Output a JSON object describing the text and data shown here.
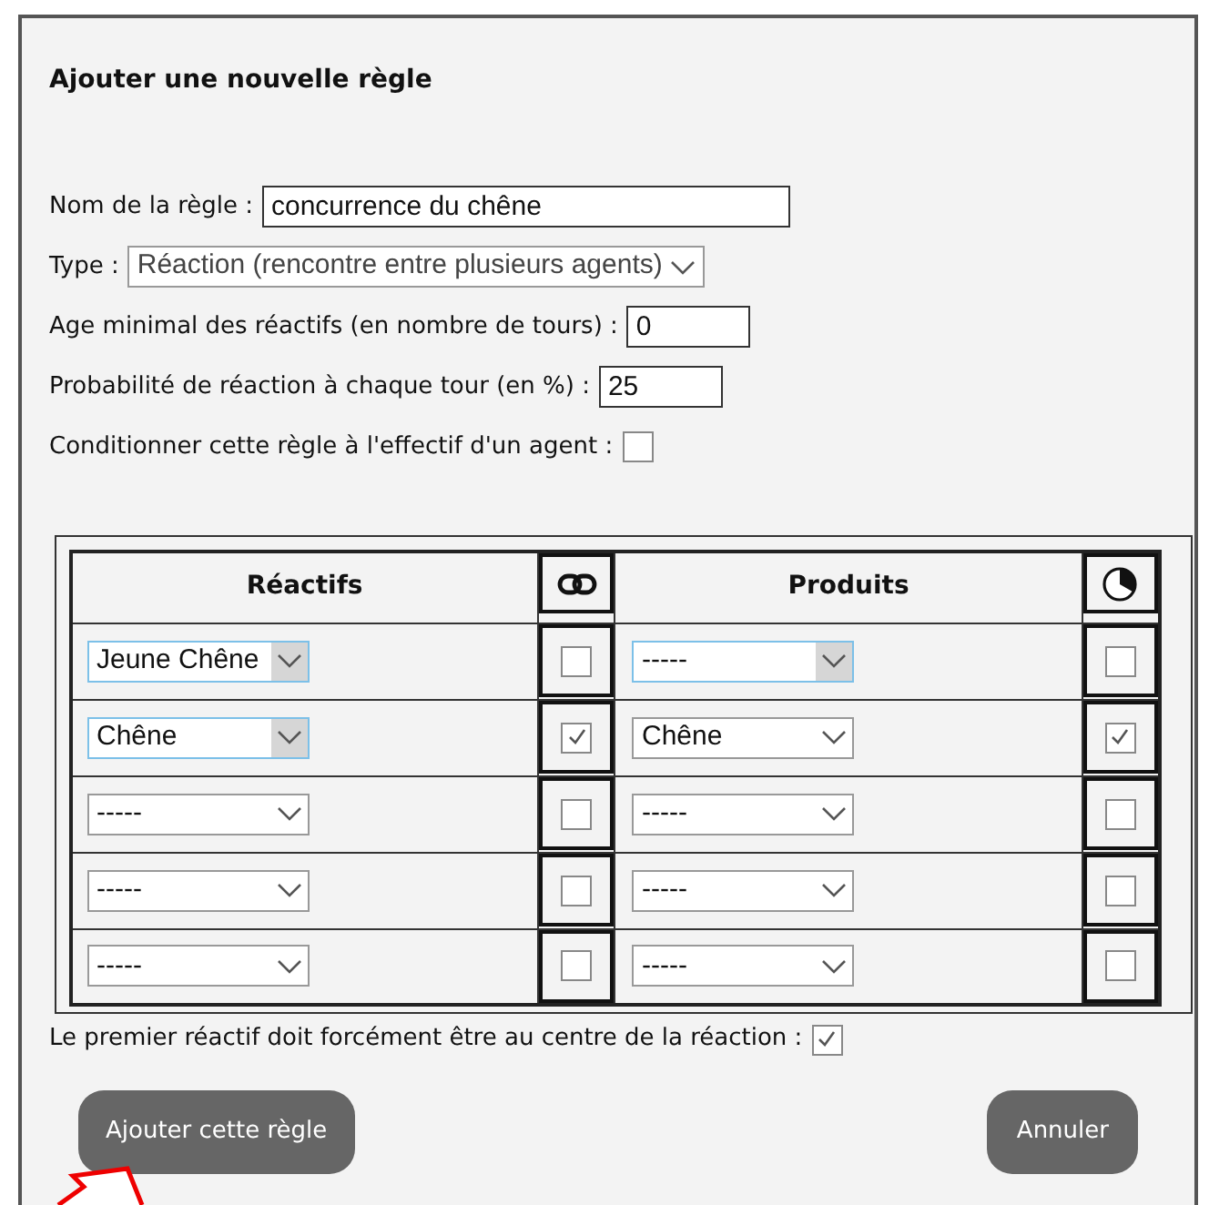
{
  "dialog": {
    "title": "Ajouter une nouvelle règle"
  },
  "fields": {
    "name": {
      "label": "Nom de la règle :",
      "value": "concurrence du chêne"
    },
    "type": {
      "label": "Type :",
      "value": "Réaction (rencontre entre plusieurs agents)"
    },
    "min_age": {
      "label": "Age minimal des réactifs (en nombre de tours) :",
      "value": "0"
    },
    "probability": {
      "label": "Probabilité de réaction à chaque tour (en %) :",
      "value": "25"
    },
    "condition": {
      "label": "Conditionner cette règle à l'effectif d'un agent :",
      "checked": false
    }
  },
  "table": {
    "columns": [
      "Réactifs",
      "Produits"
    ],
    "rows": [
      {
        "reactant": {
          "value": "Jeune Chêne",
          "highlighted": true
        },
        "linked": false,
        "product": {
          "value": "-----",
          "highlighted": true
        },
        "timed": false
      },
      {
        "reactant": {
          "value": "Chêne",
          "highlighted": true
        },
        "linked": true,
        "product": {
          "value": "Chêne",
          "highlighted": false
        },
        "timed": true
      },
      {
        "reactant": {
          "value": "-----",
          "highlighted": false
        },
        "linked": false,
        "product": {
          "value": "-----",
          "highlighted": false
        },
        "timed": false
      },
      {
        "reactant": {
          "value": "-----",
          "highlighted": false
        },
        "linked": false,
        "product": {
          "value": "-----",
          "highlighted": false
        },
        "timed": false
      },
      {
        "reactant": {
          "value": "-----",
          "highlighted": false
        },
        "linked": false,
        "product": {
          "value": "-----",
          "highlighted": false
        },
        "timed": false
      }
    ]
  },
  "center_rule": {
    "label": "Le premier réactif doit forcément être au centre de la réaction :",
    "checked": true
  },
  "buttons": [
    {
      "label": "Ajouter cette règle",
      "kind": "confirm"
    },
    {
      "label": "Annuler",
      "kind": "cancel"
    }
  ]
}
